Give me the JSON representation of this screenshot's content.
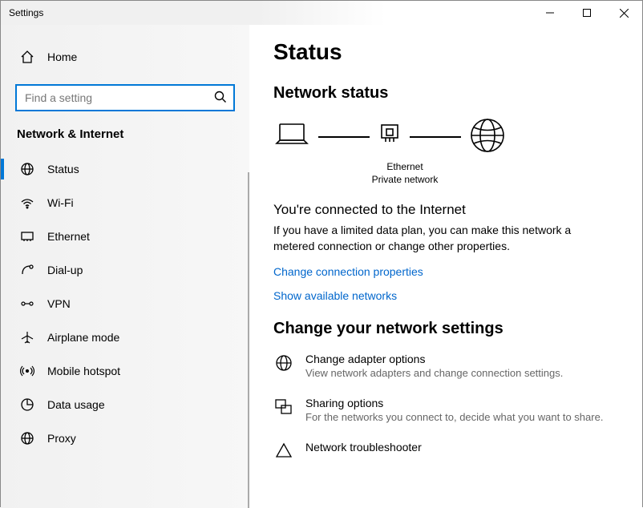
{
  "window": {
    "title": "Settings"
  },
  "sidebar": {
    "home_label": "Home",
    "search_placeholder": "Find a setting",
    "category_title": "Network & Internet",
    "items": [
      {
        "label": "Status"
      },
      {
        "label": "Wi-Fi"
      },
      {
        "label": "Ethernet"
      },
      {
        "label": "Dial-up"
      },
      {
        "label": "VPN"
      },
      {
        "label": "Airplane mode"
      },
      {
        "label": "Mobile hotspot"
      },
      {
        "label": "Data usage"
      },
      {
        "label": "Proxy"
      }
    ]
  },
  "main": {
    "page_title": "Status",
    "network_status_heading": "Network status",
    "diagram": {
      "connection_name": "Ethernet",
      "network_type": "Private network"
    },
    "connected_heading": "You're connected to the Internet",
    "connected_desc": "If you have a limited data plan, you can make this network a metered connection or change other properties.",
    "link_change_props": "Change connection properties",
    "link_show_networks": "Show available networks",
    "change_settings_heading": "Change your network settings",
    "options": [
      {
        "title": "Change adapter options",
        "sub": "View network adapters and change connection settings."
      },
      {
        "title": "Sharing options",
        "sub": "For the networks you connect to, decide what you want to share."
      },
      {
        "title": "Network troubleshooter",
        "sub": ""
      }
    ]
  }
}
